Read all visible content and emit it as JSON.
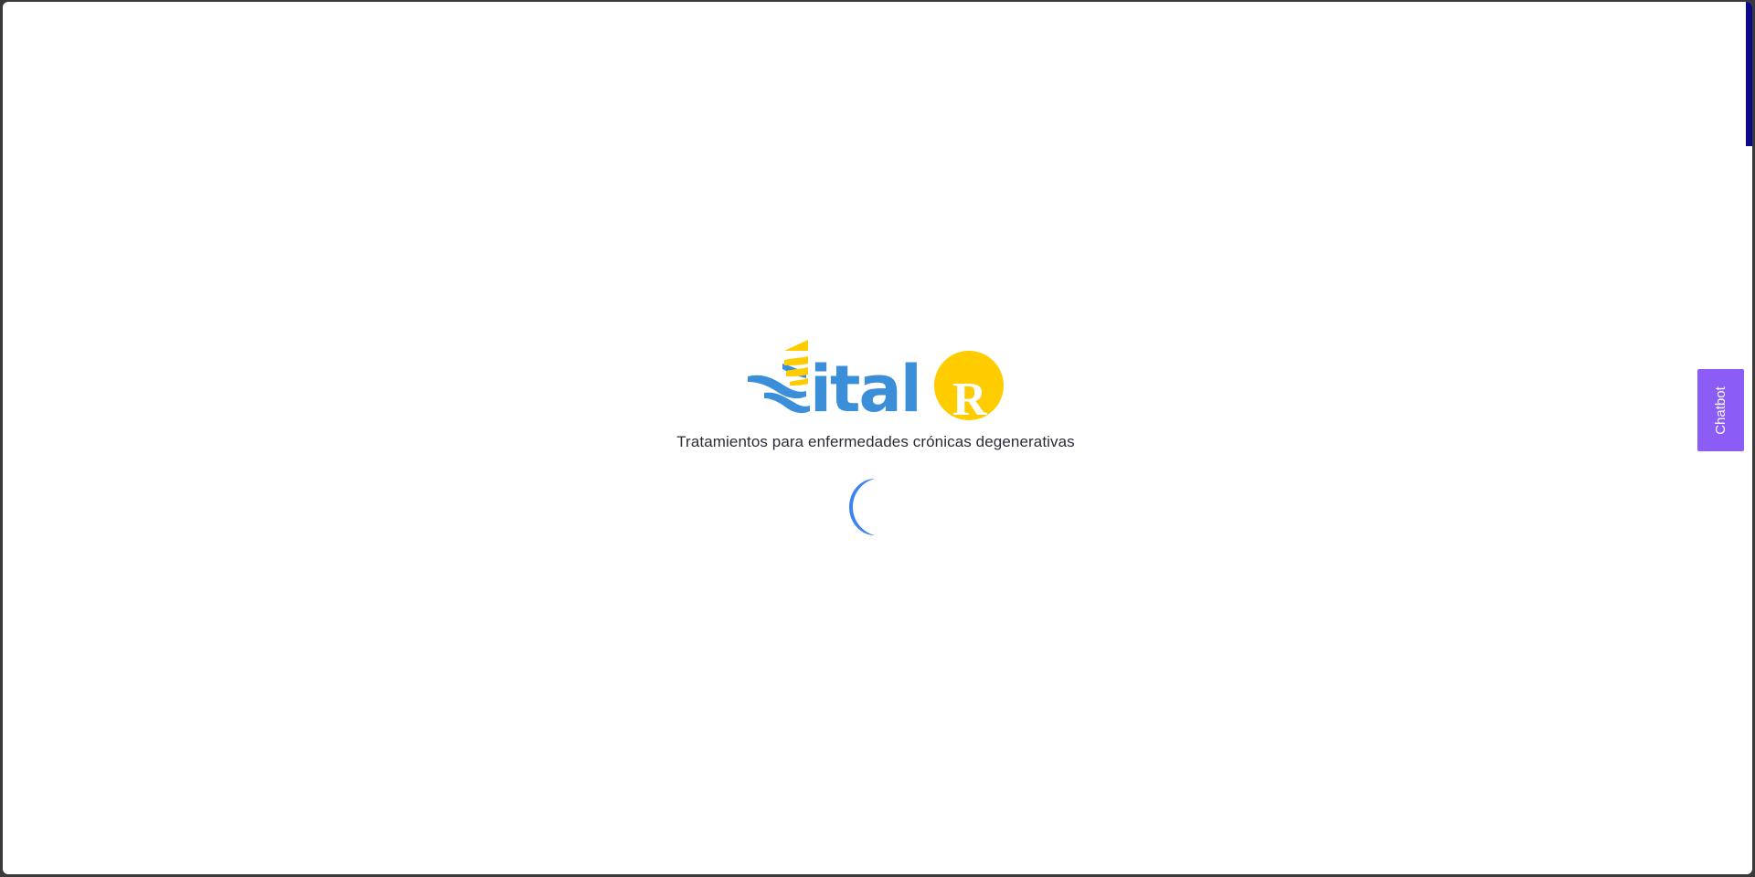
{
  "brand": {
    "logo_text": "ital",
    "logo_badge": "R",
    "tagline": "Tratamientos para enfermedades crónicas degenerativas"
  },
  "loader": {
    "state": "loading",
    "spinner_color": "#3b82f6"
  },
  "chatbot": {
    "label": "Chatbot",
    "color": "#8b5cf6"
  },
  "colors": {
    "logo_blue": "#3b8fd9",
    "logo_yellow": "#ffcc00",
    "page_background": "#ffffff",
    "scroll_indicator": "#0a0a8a"
  }
}
